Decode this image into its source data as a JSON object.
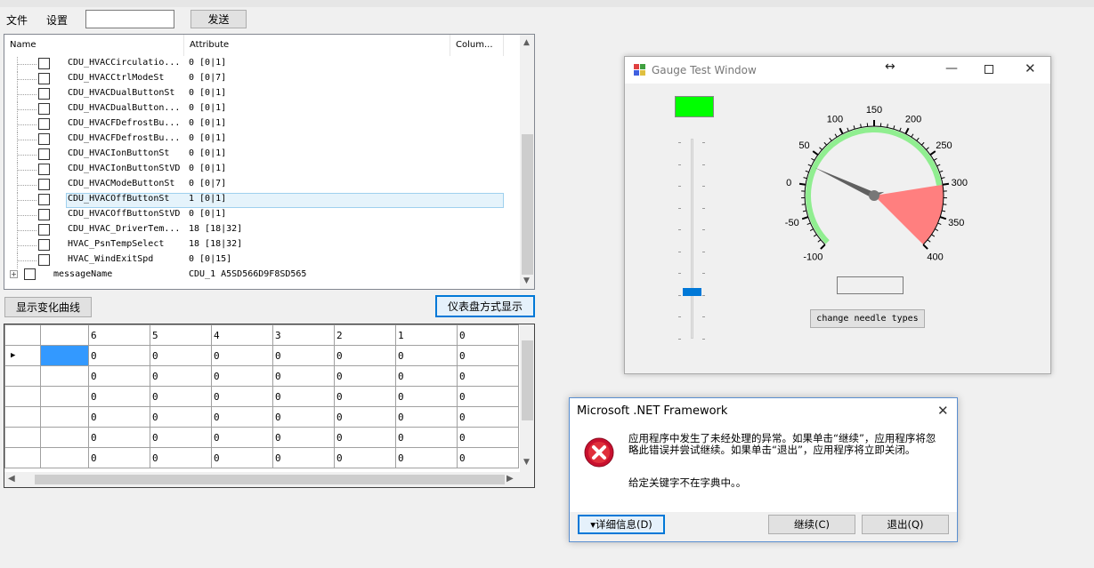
{
  "menu": {
    "file": "文件",
    "settings": "设置",
    "send": "发送",
    "input_value": ""
  },
  "tree": {
    "headers": [
      "Name",
      "Attribute",
      "Colum..."
    ],
    "rows": [
      {
        "name": "CDU_HVACCirculatio...",
        "attr": "0 [0|1]"
      },
      {
        "name": "CDU_HVACCtrlModeSt",
        "attr": "0 [0|7]"
      },
      {
        "name": "CDU_HVACDualButtonSt",
        "attr": "0 [0|1]"
      },
      {
        "name": "CDU_HVACDualButton...",
        "attr": "0 [0|1]"
      },
      {
        "name": "CDU_HVACFDefrostBu...",
        "attr": "0 [0|1]"
      },
      {
        "name": "CDU_HVACFDefrostBu...",
        "attr": "0 [0|1]"
      },
      {
        "name": "CDU_HVACIonButtonSt",
        "attr": "0 [0|1]"
      },
      {
        "name": "CDU_HVACIonButtonStVD",
        "attr": "0 [0|1]"
      },
      {
        "name": "CDU_HVACModeButtonSt",
        "attr": "0 [0|7]"
      },
      {
        "name": "CDU_HVACOffButtonSt",
        "attr": "1 [0|1]"
      },
      {
        "name": "CDU_HVACOffButtonStVD",
        "attr": "0 [0|1]"
      },
      {
        "name": "CDU_HVAC_DriverTem...",
        "attr": "18 [18|32]"
      },
      {
        "name": "HVAC_PsnTempSelect",
        "attr": "18 [18|32]"
      },
      {
        "name": "HVAC_WindExitSpd",
        "attr": "0 [0|15]"
      }
    ],
    "root": {
      "name": "messageName",
      "attr": "CDU_1 A5SD566D9F8SD565"
    },
    "selected_index": 9
  },
  "buttons": {
    "show_curve": "显示变化曲线",
    "show_gauge": "仪表盘方式显示"
  },
  "grid": {
    "columns": [
      "",
      "6",
      "5",
      "4",
      "3",
      "2",
      "1",
      "0"
    ],
    "rows": [
      [
        "",
        "0",
        "0",
        "0",
        "0",
        "0",
        "0",
        "0"
      ],
      [
        "",
        "0",
        "0",
        "0",
        "0",
        "0",
        "0",
        "0"
      ],
      [
        "",
        "0",
        "0",
        "0",
        "0",
        "0",
        "0",
        "0"
      ],
      [
        "",
        "0",
        "0",
        "0",
        "0",
        "0",
        "0",
        "0"
      ],
      [
        "",
        "0",
        "0",
        "0",
        "0",
        "0",
        "0",
        "0"
      ],
      [
        "",
        "0",
        "0",
        "0",
        "0",
        "0",
        "0",
        "0"
      ]
    ]
  },
  "gauge_window": {
    "title": "Gauge Test Window",
    "change_button": "change needle types",
    "readout": "",
    "ticks": [
      "-100",
      "-50",
      "0",
      "50",
      "100",
      "150",
      "200",
      "250",
      "300",
      "350",
      "400"
    ],
    "min": -100,
    "max": 400,
    "needle_value": 30,
    "red_from": 300,
    "red_to": 400,
    "green_from": -100,
    "green_to": 300,
    "slider_fraction": 0.22,
    "colors": {
      "indicator": "#00ff00",
      "red_zone": "#ff7f7f",
      "green_band": "#90ee90"
    }
  },
  "dialog": {
    "title": "Microsoft .NET Framework",
    "message": "应用程序中发生了未经处理的异常。如果单击“继续”，应用程序将忽略此错误并尝试继续。如果单击“退出”，应用程序将立即关闭。",
    "detail": "给定关键字不在字典中。。",
    "details_button": "▾详细信息(D)",
    "continue_button": "继续(C)",
    "quit_button": "退出(Q)"
  }
}
